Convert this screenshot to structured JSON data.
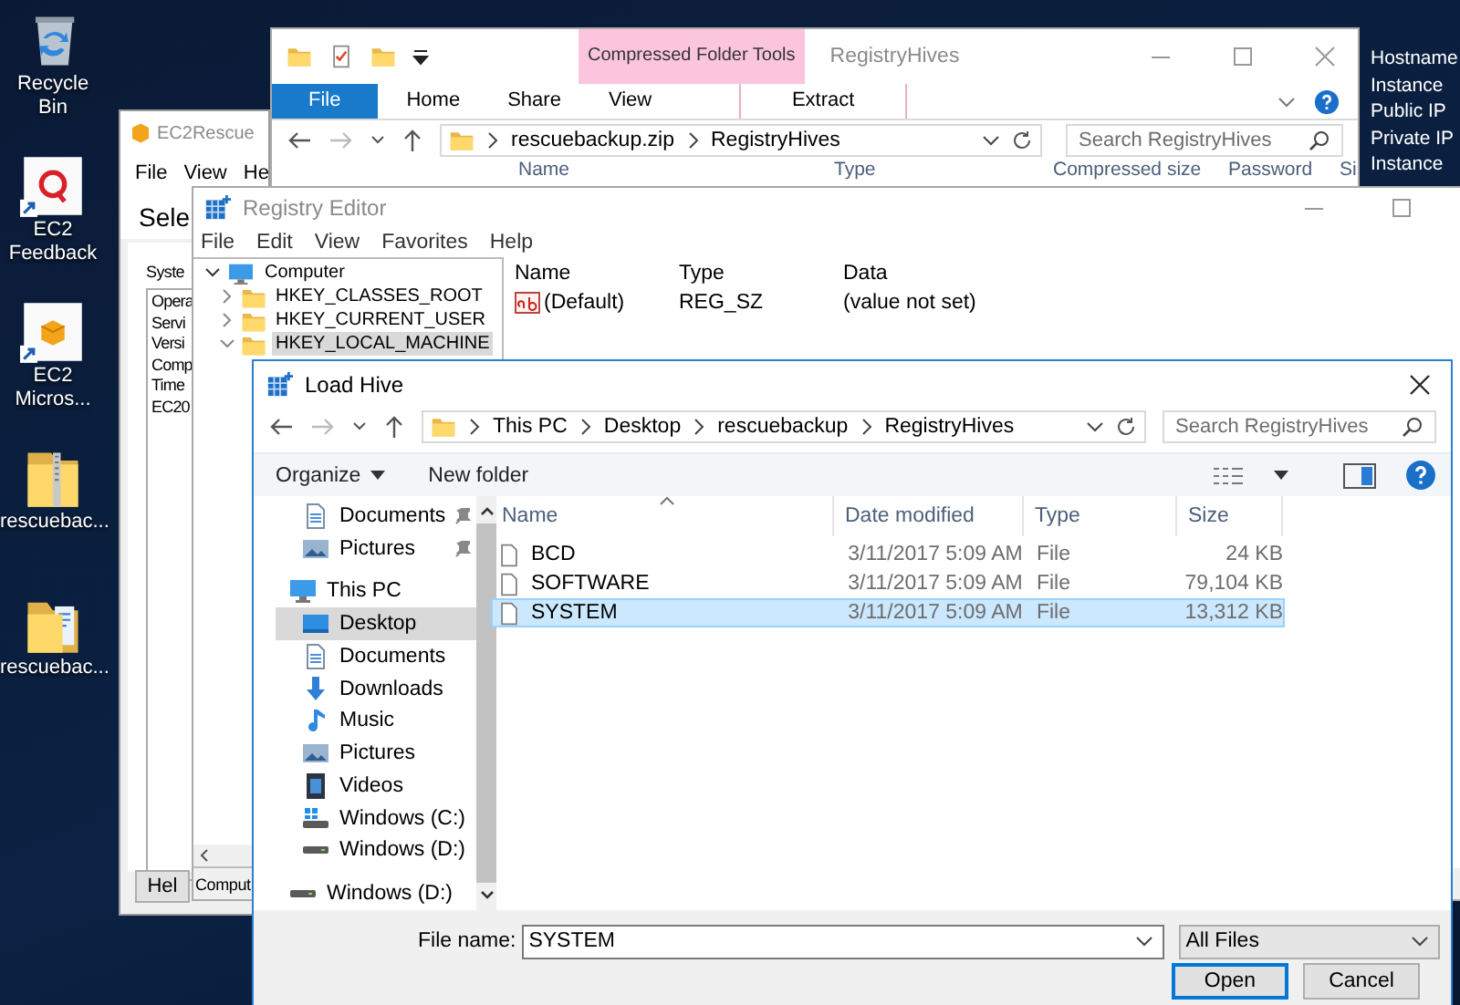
{
  "desktop_icons": [
    {
      "label": "Recycle Bin",
      "kind": "recycle"
    },
    {
      "label": "EC2 Feedback",
      "kind": "feedback"
    },
    {
      "label": "EC2 Micros...",
      "kind": "box"
    },
    {
      "label": "rescuebac...",
      "kind": "zip"
    },
    {
      "label": "rescuebac...",
      "kind": "folder"
    }
  ],
  "instance_info": [
    "Hostname",
    "Instance",
    "Public IP",
    "Private IP",
    "Instance"
  ],
  "ec2rescue": {
    "title": "EC2Rescue",
    "menu": [
      "File",
      "View",
      "He"
    ],
    "heading": "Sele",
    "group_label": "Syste",
    "list": [
      "Opera",
      "Servi",
      "Versi",
      "Comp",
      "Time",
      "EC20"
    ],
    "button": "Hel"
  },
  "explorer": {
    "title": "RegistryHives",
    "context_tab": "Compressed Folder Tools",
    "tabs": [
      {
        "label": "File",
        "kind": "file"
      },
      {
        "label": "Home",
        "kind": "tab"
      },
      {
        "label": "Share",
        "kind": "tab"
      },
      {
        "label": "View",
        "kind": "tab"
      },
      {
        "label": "Extract",
        "kind": "context"
      }
    ],
    "address": [
      "rescuebackup.zip",
      "RegistryHives"
    ],
    "search": {
      "placeholder": "Search RegistryHives"
    },
    "columns": [
      "Name",
      "Type",
      "Compressed size",
      "Password",
      "Si"
    ]
  },
  "registry_editor": {
    "title": "Registry Editor",
    "menu": [
      "File",
      "Edit",
      "View",
      "Favorites",
      "Help"
    ],
    "tree": [
      {
        "label": "Computer",
        "expanded": true,
        "selected": false,
        "children": [
          {
            "label": "HKEY_CLASSES_ROOT",
            "expanded": false,
            "selected": false
          },
          {
            "label": "HKEY_CURRENT_USER",
            "expanded": false,
            "selected": false
          },
          {
            "label": "HKEY_LOCAL_MACHINE",
            "expanded": true,
            "selected": true
          }
        ]
      }
    ],
    "columns": [
      "Name",
      "Type",
      "Data"
    ],
    "values": [
      {
        "name": "(Default)",
        "type": "REG_SZ",
        "data": "(value not set)"
      }
    ],
    "status": "Comput"
  },
  "load_hive": {
    "title": "Load Hive",
    "address": [
      "This PC",
      "Desktop",
      "rescuebackup",
      "RegistryHives"
    ],
    "search": {
      "placeholder": "Search RegistryHives"
    },
    "toolbar": [
      "Organize",
      "New folder"
    ],
    "nav": [
      {
        "label": "Documents",
        "kind": "documents",
        "pinned": true,
        "selected": false
      },
      {
        "label": "Pictures",
        "kind": "pictures",
        "pinned": true,
        "selected": false
      },
      {
        "label": "This PC",
        "kind": "pc",
        "pinned": false,
        "selected": false,
        "children": [
          {
            "label": "Desktop",
            "kind": "desktop",
            "selected": true
          },
          {
            "label": "Documents",
            "kind": "documents",
            "selected": false
          },
          {
            "label": "Downloads",
            "kind": "downloads",
            "selected": false
          },
          {
            "label": "Music",
            "kind": "music",
            "selected": false
          },
          {
            "label": "Pictures",
            "kind": "pictures",
            "selected": false
          },
          {
            "label": "Videos",
            "kind": "videos",
            "selected": false
          },
          {
            "label": "Windows (C:)",
            "kind": "drivewin",
            "selected": false
          },
          {
            "label": "Windows (D:)",
            "kind": "drive",
            "selected": false
          }
        ]
      },
      {
        "label": "Windows (D:)",
        "kind": "drive",
        "pinned": false,
        "selected": false
      }
    ],
    "columns": [
      "Name",
      "Date modified",
      "Type",
      "Size"
    ],
    "files": [
      {
        "name": "BCD",
        "date": "3/11/2017 5:09 AM",
        "type": "File",
        "size": "24 KB",
        "selected": false
      },
      {
        "name": "SOFTWARE",
        "date": "3/11/2017 5:09 AM",
        "type": "File",
        "size": "79,104 KB",
        "selected": false
      },
      {
        "name": "SYSTEM",
        "date": "3/11/2017 5:09 AM",
        "type": "File",
        "size": "13,312 KB",
        "selected": true
      }
    ],
    "file_name_label": "File name:",
    "file_name": "SYSTEM",
    "filter": "All Files",
    "buttons": [
      "Open",
      "Cancel"
    ]
  }
}
